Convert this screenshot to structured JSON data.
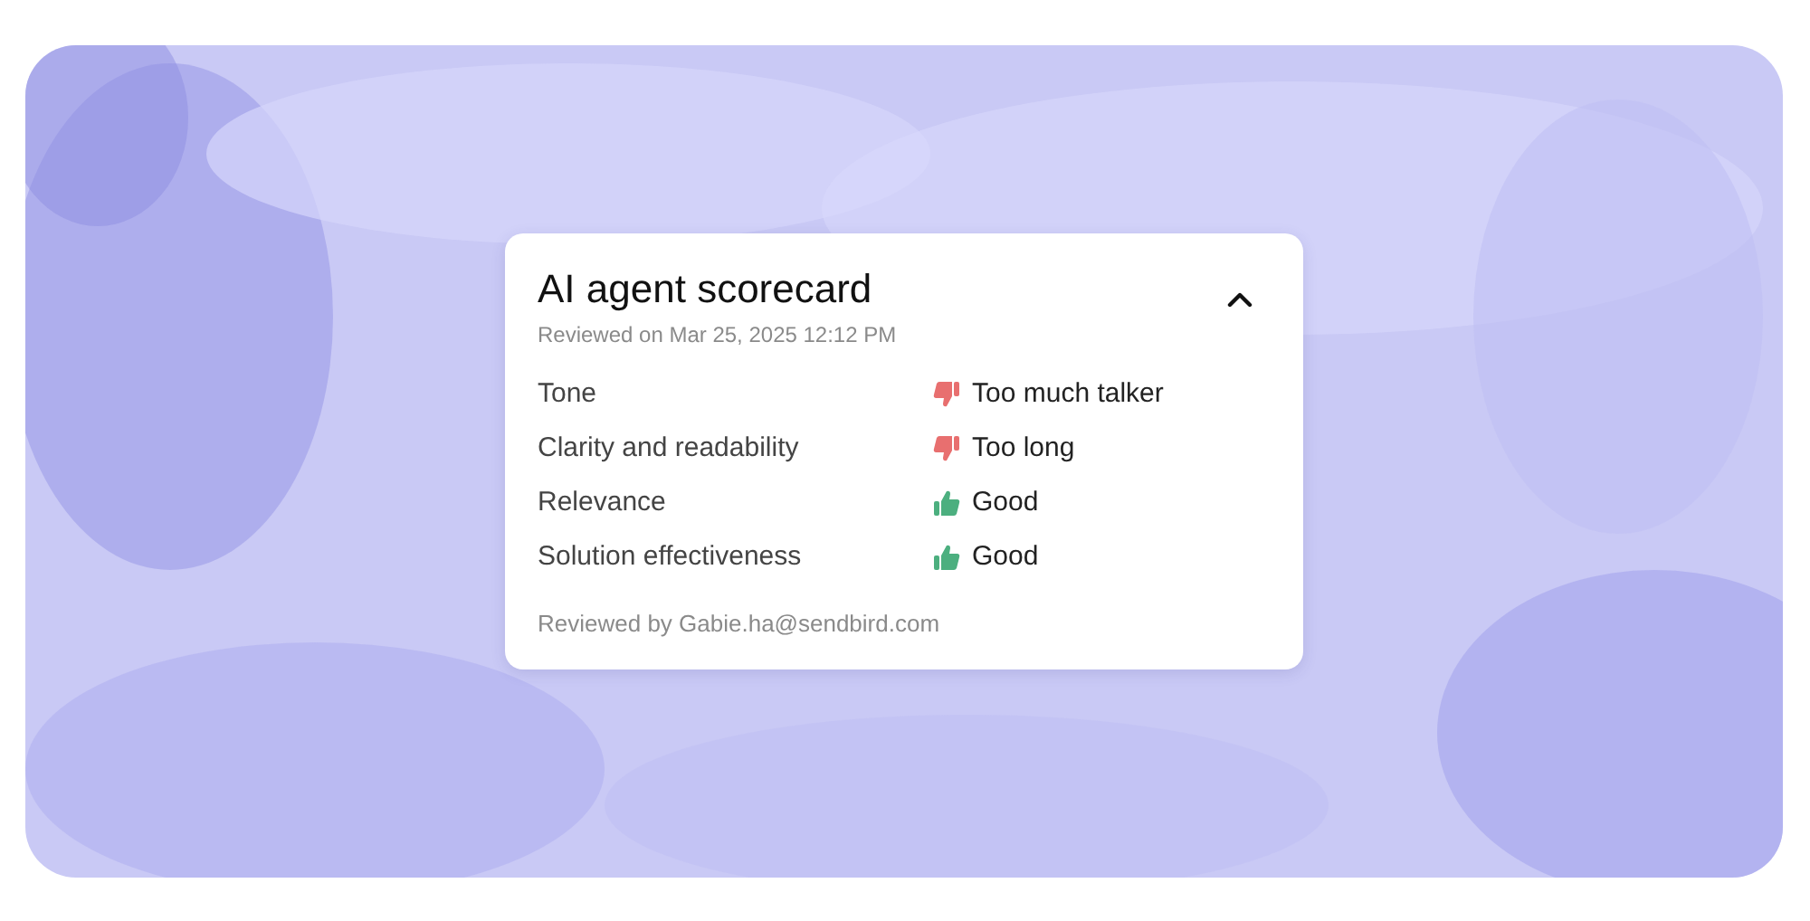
{
  "scorecard": {
    "title": "AI agent scorecard",
    "subtitle": "Reviewed on Mar 25, 2025 12:12 PM",
    "expanded": true,
    "criteria": [
      {
        "label": "Tone",
        "kind": "down",
        "value": "Too much talker"
      },
      {
        "label": "Clarity and readability",
        "kind": "down",
        "value": "Too long"
      },
      {
        "label": "Relevance",
        "kind": "up",
        "value": "Good"
      },
      {
        "label": "Solution effectiveness",
        "kind": "up",
        "value": "Good"
      }
    ],
    "footer": "Reviewed by Gabie.ha@sendbird.com"
  }
}
